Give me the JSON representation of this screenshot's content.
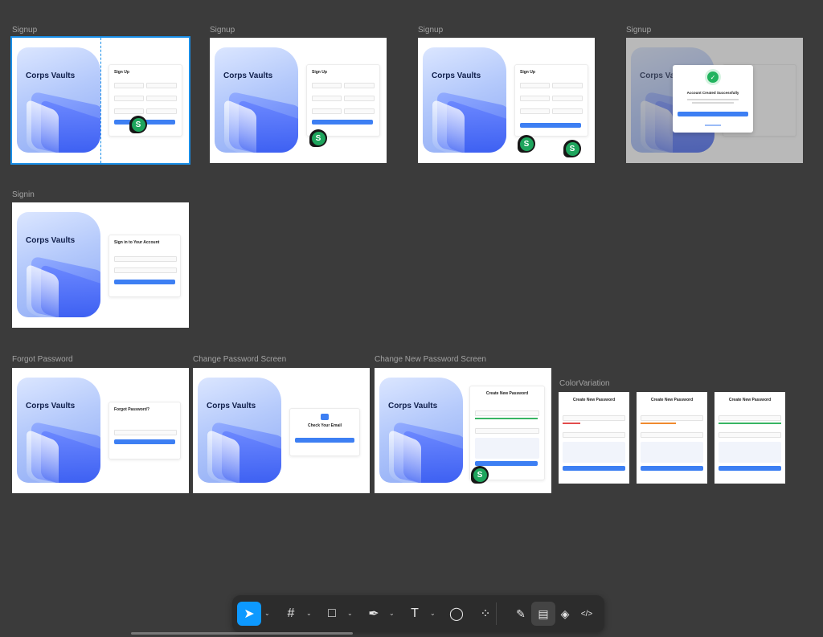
{
  "frames": {
    "signup_1": {
      "label": "Signup",
      "hero_title": "Corps Vaults",
      "form_title": "Sign Up",
      "badge": "S"
    },
    "signup_2": {
      "label": "Signup",
      "hero_title": "Corps Vaults",
      "form_title": "Sign Up",
      "badge": "S"
    },
    "signup_3": {
      "label": "Signup",
      "hero_title": "Corps Vaults",
      "form_title": "Sign Up",
      "badge_a": "S",
      "badge_b": "S"
    },
    "signup_4": {
      "label": "Signup",
      "hero_title": "Corps Va",
      "modal_title": "Account Created Successfully",
      "check": "✓"
    },
    "signin": {
      "label": "Signin",
      "hero_title": "Corps Vaults",
      "form_title": "Sign in to Your Account"
    },
    "forgot": {
      "label": "Forgot Password",
      "hero_title": "Corps Vaults",
      "form_title": "Forgot Password?"
    },
    "change_pw": {
      "label": "Change Password Screen",
      "hero_title": "Corps Vaults",
      "form_title": "Check Your Email"
    },
    "change_new_pw": {
      "label": "Change New Password Screen",
      "hero_title": "Corps Vaults",
      "form_title": "Create New Password",
      "badge": "S"
    },
    "color_variation": {
      "label": "ColorVariation",
      "cards": [
        {
          "title": "Create New Password",
          "strength_color": "#e24c4c"
        },
        {
          "title": "Create New Password",
          "strength_color": "#f08a2e"
        },
        {
          "title": "Create New Password",
          "strength_color": "#38b563"
        }
      ]
    }
  },
  "colors": {
    "canvas": "#3b3b3b",
    "accent": "#0d99ff",
    "brand_blue": "#3d7ff3",
    "badge_green": "#1ea55d"
  },
  "toolbar": {
    "tools": [
      "move-tool",
      "frame-tool",
      "shape-tool",
      "pen-tool",
      "text-tool",
      "comment-tool",
      "actions-tool"
    ],
    "right_tools": [
      "draw-mode",
      "design-mode",
      "component-mode",
      "dev-mode"
    ],
    "icons": {
      "move": "➤",
      "frame": "#",
      "shape": "□",
      "pen": "✒",
      "text": "T",
      "comment": "◯",
      "actions": "⁘",
      "draw": "✎",
      "design": "▤",
      "component": "◈",
      "dev": "</>"
    }
  }
}
